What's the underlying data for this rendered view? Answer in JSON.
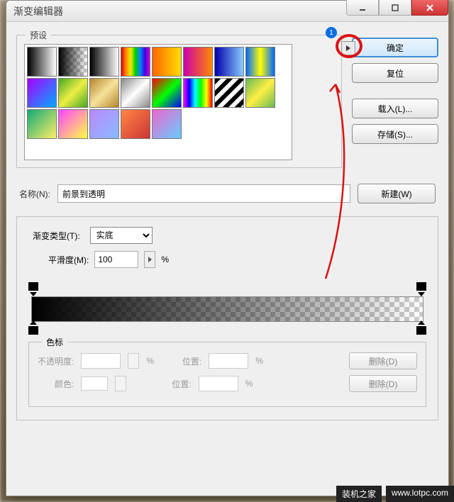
{
  "window": {
    "title": "渐变编辑器"
  },
  "presets": {
    "label": "预设",
    "callout_number": "1",
    "swatches": [
      "linear-gradient(90deg,#000,#fff)",
      "linear-gradient(90deg,#000,transparent),repeating-conic-gradient(#ccc 0 25%,#fff 0 50%) 0 0/10px 10px",
      "linear-gradient(90deg,#000,#fff)",
      "linear-gradient(90deg,#d00,#f80,#ee0,#0c0,#08f,#40d,#c0d)",
      "linear-gradient(90deg,#f60,#fd0)",
      "linear-gradient(90deg,#c0a,#f80)",
      "linear-gradient(90deg,#00a,#8cf)",
      "linear-gradient(90deg,#06f,#ff0,#06f)",
      "linear-gradient(135deg,#a0f,#0af)",
      "linear-gradient(135deg,#4a2,#ee4,#4a2)",
      "linear-gradient(135deg,#b6832d,#f6e39a,#b6832d)",
      "linear-gradient(135deg,#888,#fff,#888)",
      "linear-gradient(135deg,#f00,#0f0,#00f)",
      "linear-gradient(90deg,#f0f,#00f,#0ff,#0f0,#ff0,#f00)",
      "repeating-linear-gradient(135deg,#000 0 6px,#fff 6px 12px)",
      "linear-gradient(135deg,#6b5,#fe4,#6b5)",
      "linear-gradient(135deg,#1a7,#fe6)",
      "linear-gradient(135deg,#f4f,#ff4)",
      "linear-gradient(135deg,#b8f,#8bf)",
      "linear-gradient(135deg,#f84,#c33)",
      "linear-gradient(135deg,#e6c,#6cf)"
    ]
  },
  "buttons": {
    "ok": "确定",
    "reset": "复位",
    "load": "载入(L)...",
    "save": "存储(S)...",
    "new": "新建(W)"
  },
  "name": {
    "label": "名称(N):",
    "value": "前景到透明"
  },
  "type": {
    "label": "渐变类型(T):",
    "value": "实底"
  },
  "smoothness": {
    "label": "平滑度(M):",
    "value": "100",
    "unit": "%"
  },
  "stops": {
    "label": "色标",
    "opacity_label": "不透明度:",
    "color_label": "颜色:",
    "position_label": "位置:",
    "unit": "%",
    "delete": "删除(D)"
  },
  "watermark": {
    "a": "装机之家",
    "b": "www.lotpc.com"
  }
}
